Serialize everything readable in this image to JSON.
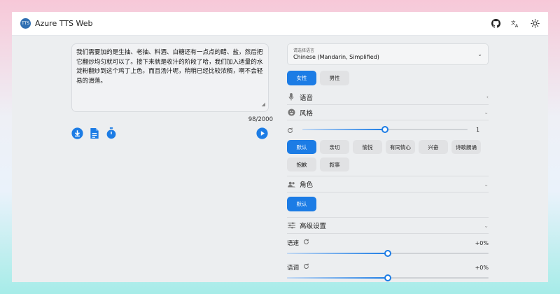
{
  "app": {
    "title": "Azure TTS Web",
    "logo_text": "TTS"
  },
  "topbar": {
    "icons": [
      "github-icon",
      "translate-icon",
      "sun-icon"
    ]
  },
  "editor": {
    "text": "我们需要加的是生抽、老抽、料酒、白糖还有一点点的醋、盐，然后把它翻炒均匀就可以了。接下来就是收汁的阶段了哈，我们加入适量的水淀粉翻炒到这个鸡丁上色，而且汤汁呢，稍稍已经比较浓稠，啊不会轻易的滑落。",
    "counter": "98/2000",
    "actions": [
      "download-icon",
      "document-icon",
      "timer-icon"
    ],
    "play_icon": "play-icon"
  },
  "language": {
    "placeholder": "请选择语言",
    "value": "Chinese (Mandarin, Simplified)"
  },
  "gender": {
    "options": [
      "女性",
      "男性"
    ],
    "selected": 0
  },
  "sections": {
    "voice": "语音",
    "style": "风格",
    "role": "角色",
    "advanced": "高级设置"
  },
  "style": {
    "degree_value": "1",
    "degree_fraction": 0.5,
    "options": [
      "默认",
      "亲切",
      "愉悦",
      "有同情心",
      "兴奋",
      "诗歌朗诵",
      "抱歉",
      "叙事"
    ],
    "selected": 0
  },
  "role": {
    "options": [
      "默认"
    ],
    "selected": 0
  },
  "advanced": {
    "rate_label": "语速",
    "rate_value": "+0%",
    "rate_fraction": 0.5,
    "pitch_label": "语调",
    "pitch_value": "+0%",
    "pitch_fraction": 0.5
  },
  "colors": {
    "accent": "#1c7ce5"
  }
}
